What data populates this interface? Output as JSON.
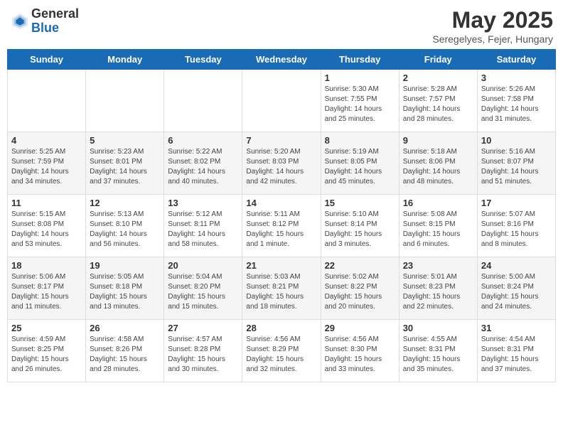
{
  "header": {
    "logo_general": "General",
    "logo_blue": "Blue",
    "month_title": "May 2025",
    "location": "Seregelyes, Fejer, Hungary"
  },
  "weekdays": [
    "Sunday",
    "Monday",
    "Tuesday",
    "Wednesday",
    "Thursday",
    "Friday",
    "Saturday"
  ],
  "weeks": [
    [
      {
        "day": "",
        "sunrise": "",
        "sunset": "",
        "daylight": ""
      },
      {
        "day": "",
        "sunrise": "",
        "sunset": "",
        "daylight": ""
      },
      {
        "day": "",
        "sunrise": "",
        "sunset": "",
        "daylight": ""
      },
      {
        "day": "",
        "sunrise": "",
        "sunset": "",
        "daylight": ""
      },
      {
        "day": "1",
        "sunrise": "Sunrise: 5:30 AM",
        "sunset": "Sunset: 7:55 PM",
        "daylight": "Daylight: 14 hours and 25 minutes."
      },
      {
        "day": "2",
        "sunrise": "Sunrise: 5:28 AM",
        "sunset": "Sunset: 7:57 PM",
        "daylight": "Daylight: 14 hours and 28 minutes."
      },
      {
        "day": "3",
        "sunrise": "Sunrise: 5:26 AM",
        "sunset": "Sunset: 7:58 PM",
        "daylight": "Daylight: 14 hours and 31 minutes."
      }
    ],
    [
      {
        "day": "4",
        "sunrise": "Sunrise: 5:25 AM",
        "sunset": "Sunset: 7:59 PM",
        "daylight": "Daylight: 14 hours and 34 minutes."
      },
      {
        "day": "5",
        "sunrise": "Sunrise: 5:23 AM",
        "sunset": "Sunset: 8:01 PM",
        "daylight": "Daylight: 14 hours and 37 minutes."
      },
      {
        "day": "6",
        "sunrise": "Sunrise: 5:22 AM",
        "sunset": "Sunset: 8:02 PM",
        "daylight": "Daylight: 14 hours and 40 minutes."
      },
      {
        "day": "7",
        "sunrise": "Sunrise: 5:20 AM",
        "sunset": "Sunset: 8:03 PM",
        "daylight": "Daylight: 14 hours and 42 minutes."
      },
      {
        "day": "8",
        "sunrise": "Sunrise: 5:19 AM",
        "sunset": "Sunset: 8:05 PM",
        "daylight": "Daylight: 14 hours and 45 minutes."
      },
      {
        "day": "9",
        "sunrise": "Sunrise: 5:18 AM",
        "sunset": "Sunset: 8:06 PM",
        "daylight": "Daylight: 14 hours and 48 minutes."
      },
      {
        "day": "10",
        "sunrise": "Sunrise: 5:16 AM",
        "sunset": "Sunset: 8:07 PM",
        "daylight": "Daylight: 14 hours and 51 minutes."
      }
    ],
    [
      {
        "day": "11",
        "sunrise": "Sunrise: 5:15 AM",
        "sunset": "Sunset: 8:08 PM",
        "daylight": "Daylight: 14 hours and 53 minutes."
      },
      {
        "day": "12",
        "sunrise": "Sunrise: 5:13 AM",
        "sunset": "Sunset: 8:10 PM",
        "daylight": "Daylight: 14 hours and 56 minutes."
      },
      {
        "day": "13",
        "sunrise": "Sunrise: 5:12 AM",
        "sunset": "Sunset: 8:11 PM",
        "daylight": "Daylight: 14 hours and 58 minutes."
      },
      {
        "day": "14",
        "sunrise": "Sunrise: 5:11 AM",
        "sunset": "Sunset: 8:12 PM",
        "daylight": "Daylight: 15 hours and 1 minute."
      },
      {
        "day": "15",
        "sunrise": "Sunrise: 5:10 AM",
        "sunset": "Sunset: 8:14 PM",
        "daylight": "Daylight: 15 hours and 3 minutes."
      },
      {
        "day": "16",
        "sunrise": "Sunrise: 5:08 AM",
        "sunset": "Sunset: 8:15 PM",
        "daylight": "Daylight: 15 hours and 6 minutes."
      },
      {
        "day": "17",
        "sunrise": "Sunrise: 5:07 AM",
        "sunset": "Sunset: 8:16 PM",
        "daylight": "Daylight: 15 hours and 8 minutes."
      }
    ],
    [
      {
        "day": "18",
        "sunrise": "Sunrise: 5:06 AM",
        "sunset": "Sunset: 8:17 PM",
        "daylight": "Daylight: 15 hours and 11 minutes."
      },
      {
        "day": "19",
        "sunrise": "Sunrise: 5:05 AM",
        "sunset": "Sunset: 8:18 PM",
        "daylight": "Daylight: 15 hours and 13 minutes."
      },
      {
        "day": "20",
        "sunrise": "Sunrise: 5:04 AM",
        "sunset": "Sunset: 8:20 PM",
        "daylight": "Daylight: 15 hours and 15 minutes."
      },
      {
        "day": "21",
        "sunrise": "Sunrise: 5:03 AM",
        "sunset": "Sunset: 8:21 PM",
        "daylight": "Daylight: 15 hours and 18 minutes."
      },
      {
        "day": "22",
        "sunrise": "Sunrise: 5:02 AM",
        "sunset": "Sunset: 8:22 PM",
        "daylight": "Daylight: 15 hours and 20 minutes."
      },
      {
        "day": "23",
        "sunrise": "Sunrise: 5:01 AM",
        "sunset": "Sunset: 8:23 PM",
        "daylight": "Daylight: 15 hours and 22 minutes."
      },
      {
        "day": "24",
        "sunrise": "Sunrise: 5:00 AM",
        "sunset": "Sunset: 8:24 PM",
        "daylight": "Daylight: 15 hours and 24 minutes."
      }
    ],
    [
      {
        "day": "25",
        "sunrise": "Sunrise: 4:59 AM",
        "sunset": "Sunset: 8:25 PM",
        "daylight": "Daylight: 15 hours and 26 minutes."
      },
      {
        "day": "26",
        "sunrise": "Sunrise: 4:58 AM",
        "sunset": "Sunset: 8:26 PM",
        "daylight": "Daylight: 15 hours and 28 minutes."
      },
      {
        "day": "27",
        "sunrise": "Sunrise: 4:57 AM",
        "sunset": "Sunset: 8:28 PM",
        "daylight": "Daylight: 15 hours and 30 minutes."
      },
      {
        "day": "28",
        "sunrise": "Sunrise: 4:56 AM",
        "sunset": "Sunset: 8:29 PM",
        "daylight": "Daylight: 15 hours and 32 minutes."
      },
      {
        "day": "29",
        "sunrise": "Sunrise: 4:56 AM",
        "sunset": "Sunset: 8:30 PM",
        "daylight": "Daylight: 15 hours and 33 minutes."
      },
      {
        "day": "30",
        "sunrise": "Sunrise: 4:55 AM",
        "sunset": "Sunset: 8:31 PM",
        "daylight": "Daylight: 15 hours and 35 minutes."
      },
      {
        "day": "31",
        "sunrise": "Sunrise: 4:54 AM",
        "sunset": "Sunset: 8:31 PM",
        "daylight": "Daylight: 15 hours and 37 minutes."
      }
    ]
  ]
}
